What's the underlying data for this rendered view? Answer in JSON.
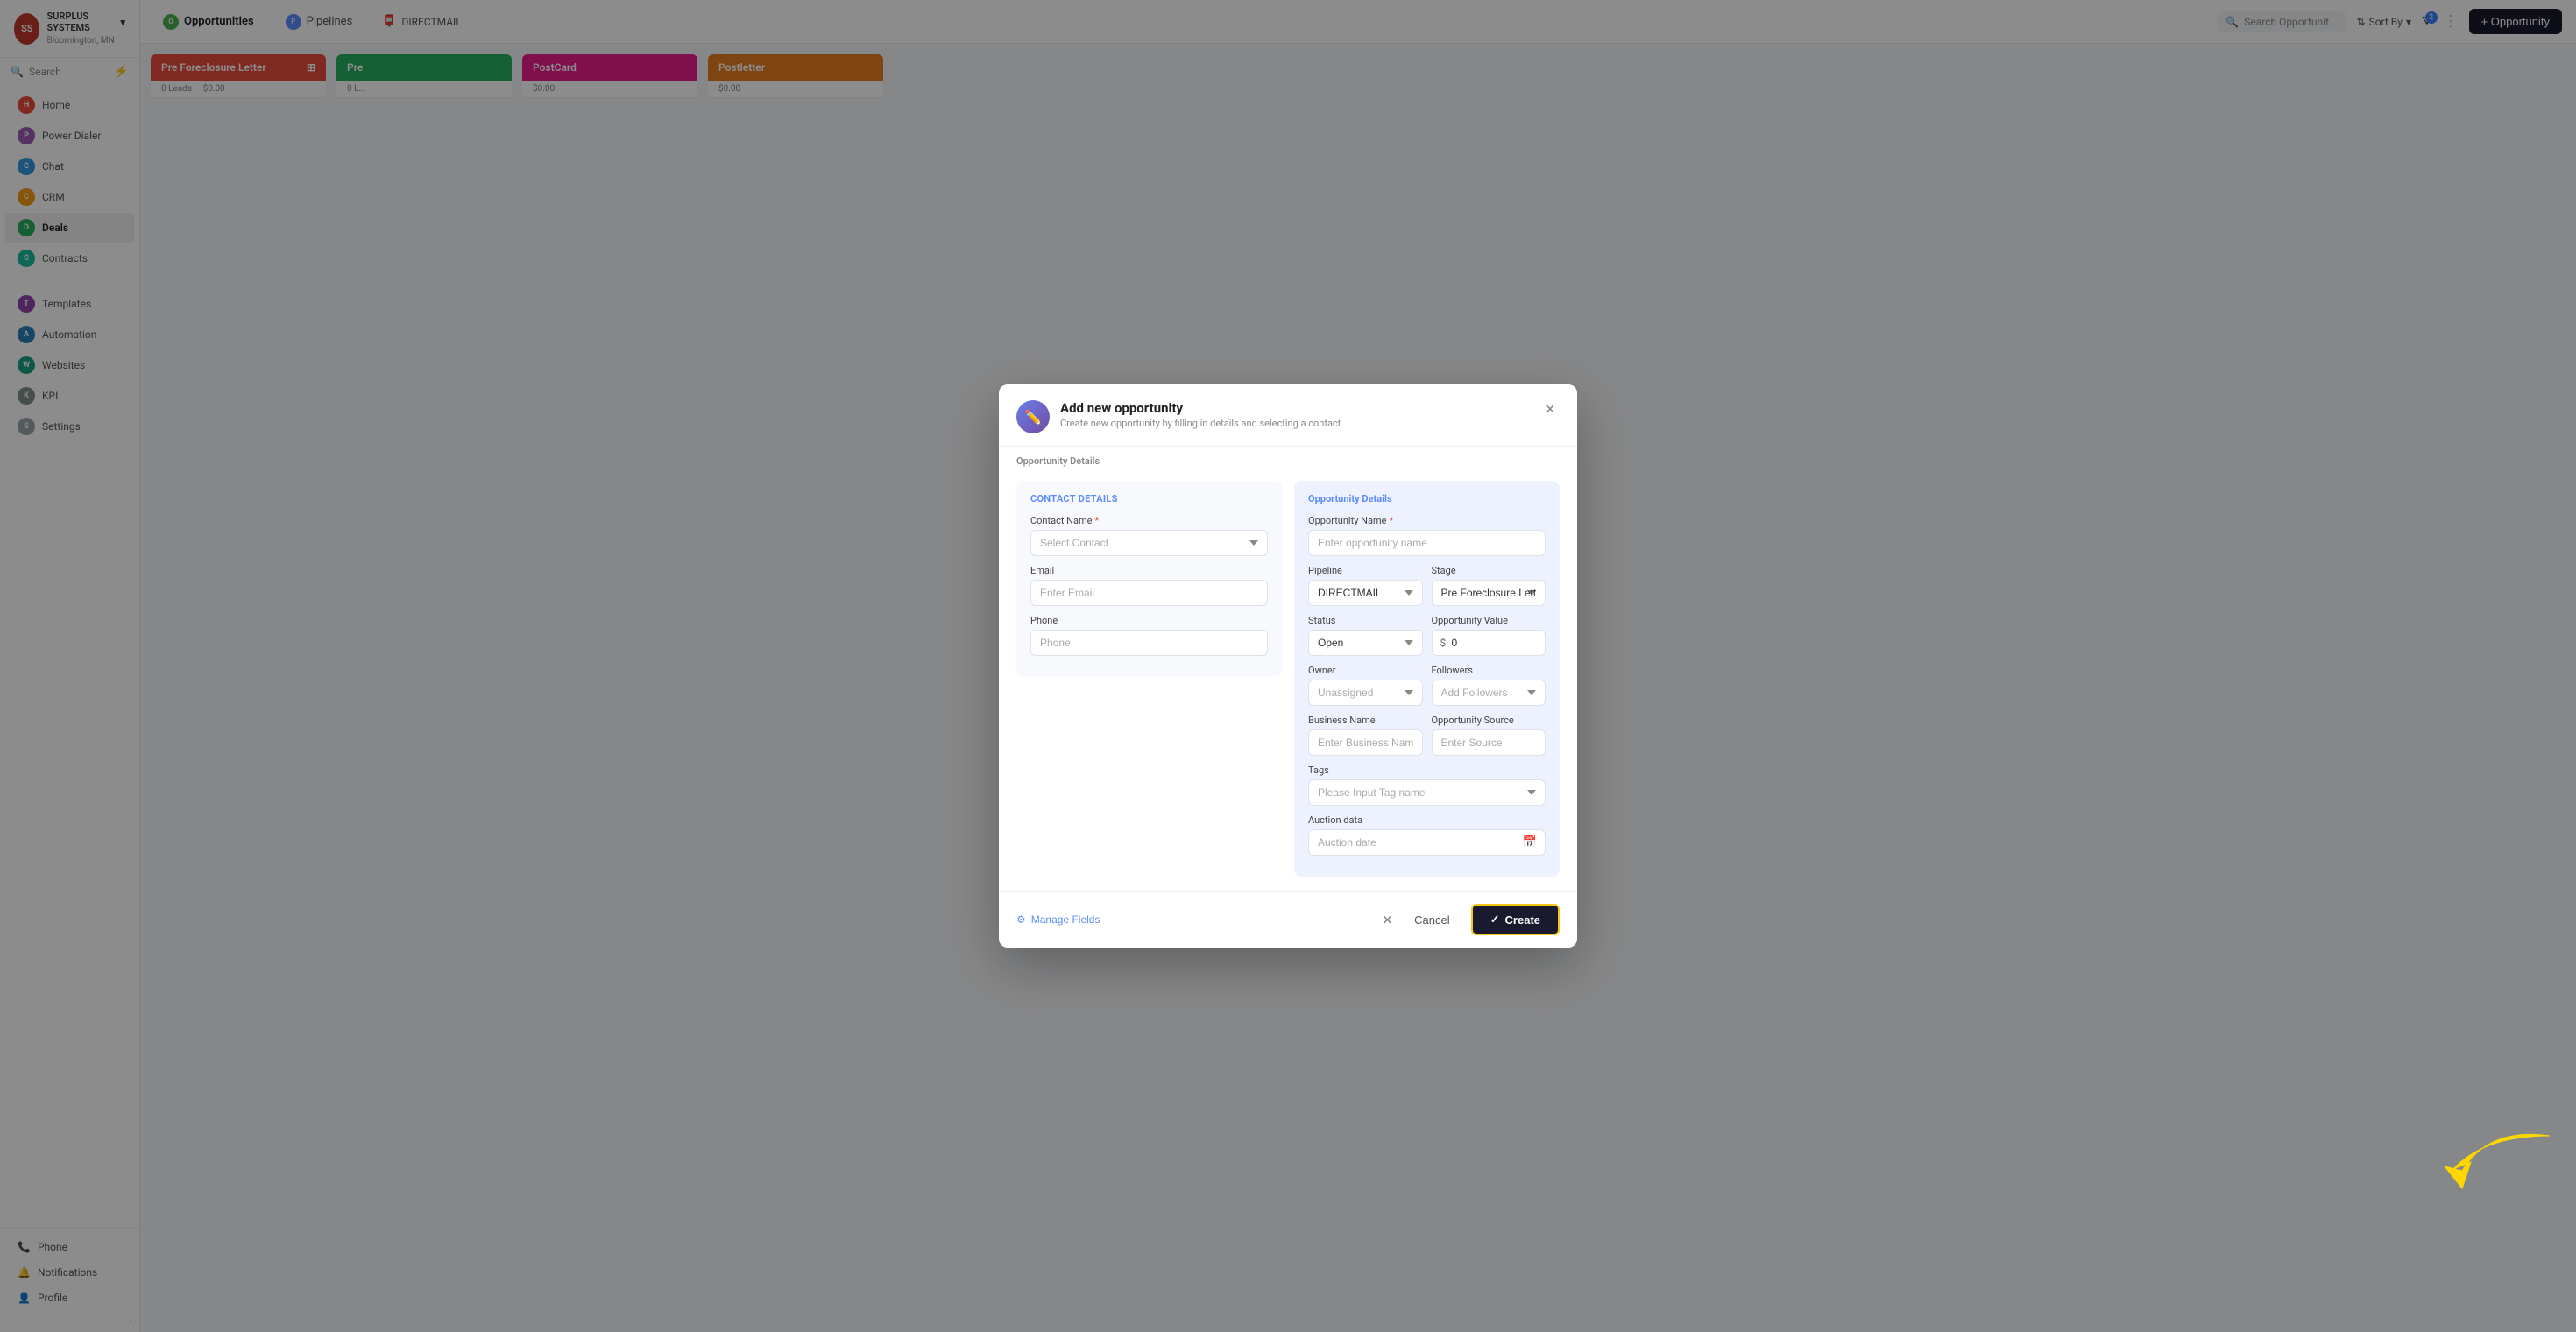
{
  "app": {
    "name": "SURPLUS SYSTEMS",
    "location": "Bloomington, MN"
  },
  "sidebar": {
    "nav_items": [
      {
        "id": "home",
        "label": "Home",
        "color": "#e74c3c"
      },
      {
        "id": "power-dialer",
        "label": "Power Dialer",
        "color": "#9b59b6"
      },
      {
        "id": "chat",
        "label": "Chat",
        "color": "#3498db"
      },
      {
        "id": "crm",
        "label": "CRM",
        "color": "#f39c12"
      },
      {
        "id": "deals",
        "label": "Deals",
        "color": "#27ae60",
        "active": true
      },
      {
        "id": "contracts",
        "label": "Contracts",
        "color": "#1abc9c"
      }
    ],
    "bottom_items": [
      {
        "id": "templates",
        "label": "Templates",
        "color": "#8e44ad"
      },
      {
        "id": "automation",
        "label": "Automation",
        "color": "#2980b9"
      },
      {
        "id": "websites",
        "label": "Websites",
        "color": "#16a085"
      },
      {
        "id": "kpi",
        "label": "KPI",
        "color": "#7f8c8d"
      },
      {
        "id": "settings",
        "label": "Settings",
        "color": "#95a5a6"
      }
    ],
    "phone_label": "Phone",
    "notifications_label": "Notifications",
    "profile_label": "Profile"
  },
  "topbar": {
    "tab_opportunities": "Opportunities",
    "tab_pipelines": "Pipelines",
    "pipeline_name": "DIRECTMAIL",
    "search_placeholder": "Search Opportunit...",
    "sort_label": "Sort By",
    "add_button": "+ Opportunity",
    "filter_badge": "2"
  },
  "kanban": {
    "columns": [
      {
        "id": "pre-foreclosure",
        "title": "Pre Foreclosure Letter",
        "leads": "0 Leads",
        "value": "$0.00",
        "color": "red"
      },
      {
        "id": "pre",
        "title": "Pre",
        "leads": "0 L...",
        "value": "",
        "color": "green"
      },
      {
        "id": "postcard",
        "title": "PostCard",
        "leads": "",
        "value": "$0.00",
        "color": "pink"
      },
      {
        "id": "postletter",
        "title": "Postletter",
        "leads": "",
        "value": "$0.00",
        "color": "orange"
      }
    ]
  },
  "modal": {
    "title": "Add new opportunity",
    "subtitle": "Create new opportunity by filling in details and selecting a contact",
    "section_label": "Opportunity Details",
    "contact_section_label": "Contact Details",
    "opportunity_section_label": "Opportunity Details",
    "close_label": "×",
    "fields": {
      "contact_name_label": "Contact Name",
      "contact_name_placeholder": "Select Contact",
      "email_label": "Email",
      "email_placeholder": "Enter Email",
      "phone_label": "Phone",
      "phone_placeholder": "Phone",
      "opportunity_name_label": "Opportunity Name",
      "opportunity_name_placeholder": "Enter opportunity name",
      "pipeline_label": "Pipeline",
      "pipeline_value": "DIRECTMAIL",
      "stage_label": "Stage",
      "stage_value": "Pre Foreclosure Letter",
      "status_label": "Status",
      "status_value": "Open",
      "opp_value_label": "Opportunity Value",
      "opp_value_prefix": "$",
      "opp_value_placeholder": "0",
      "owner_label": "Owner",
      "owner_placeholder": "Unassigned",
      "followers_label": "Followers",
      "followers_placeholder": "Add Followers",
      "business_name_label": "Business Name",
      "business_name_placeholder": "Enter Business Name",
      "opp_source_label": "Opportunity Source",
      "opp_source_placeholder": "Enter Source",
      "tags_label": "Tags",
      "tags_placeholder": "Please Input Tag name",
      "auction_data_label": "Auction data",
      "auction_date_placeholder": "Auction date"
    },
    "footer": {
      "manage_fields_label": "Manage Fields",
      "cancel_label": "Cancel",
      "create_label": "Create"
    }
  }
}
